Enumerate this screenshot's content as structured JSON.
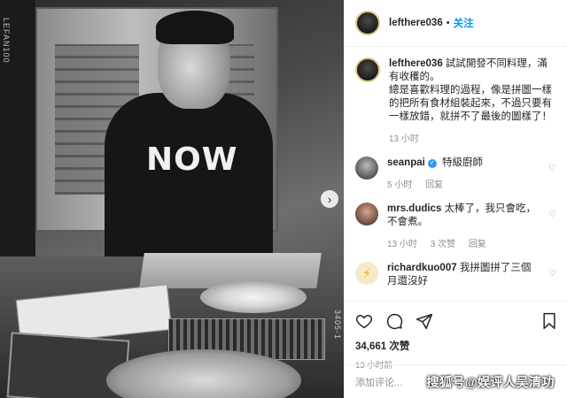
{
  "photo": {
    "shirt_text": "NOW",
    "film_left": "LEFAN100",
    "film_right": "3405-1"
  },
  "post": {
    "username": "lefthere036",
    "follow_label": "关注",
    "caption": "試試開發不同料理，滿有收穫的。\n總是喜歡料理的過程，像是拼圖一樣的把所有食材組裝起來，不過只要有一樣放錯，就拼不了最後的圖樣了！",
    "caption_time": "13 小时"
  },
  "comments": [
    {
      "user": "seanpai",
      "verified": true,
      "text": "特級廚師",
      "time": "5 小时",
      "reply": "回复",
      "likes": ""
    },
    {
      "user": "mrs.dudics",
      "verified": false,
      "text": "太棒了，我只會吃，不會煮。",
      "time": "13 小时",
      "likes": "3 次赞",
      "reply": "回复"
    },
    {
      "user": "richardkuo007",
      "verified": false,
      "text": "我拼圖拼了三個月還沒好",
      "time": "",
      "likes": "",
      "reply": ""
    }
  ],
  "actions": {
    "like_count": "34,661 次赞",
    "posted_ago": "13 小时前",
    "add_comment_placeholder": "添加评论..."
  },
  "watermark": "搜狐号@娱评人吴清功",
  "icons": [
    "heart-icon",
    "comment-icon",
    "share-icon",
    "bookmark-icon",
    "chevron-right-icon",
    "verified-icon"
  ]
}
